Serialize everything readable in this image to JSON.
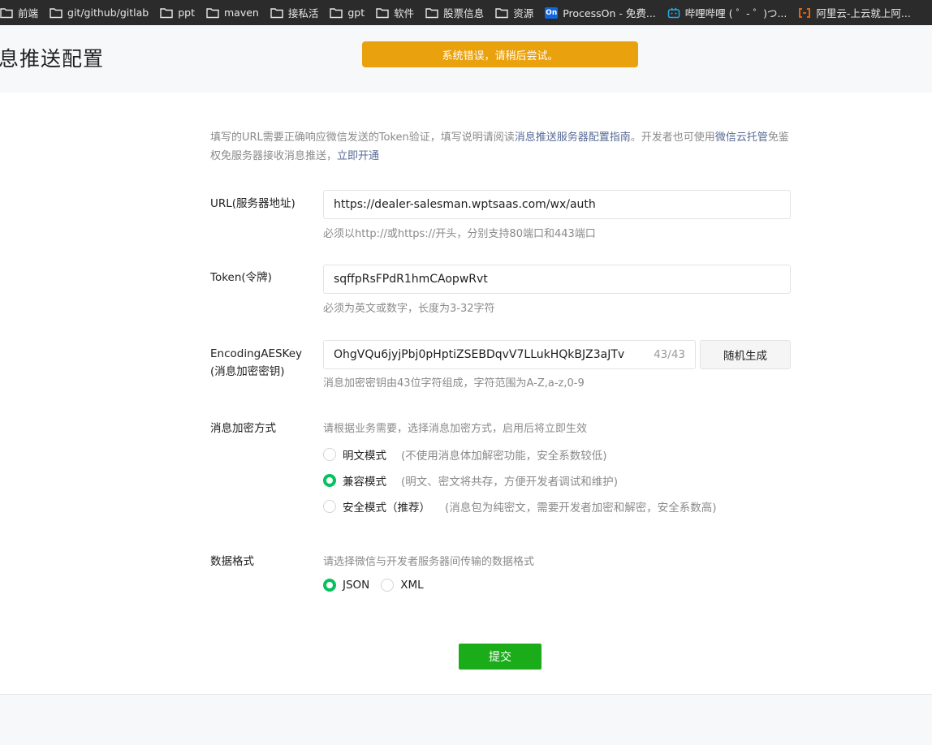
{
  "bookmarks": [
    {
      "label": "前端",
      "icon": "folder-icon"
    },
    {
      "label": "git/github/gitlab",
      "icon": "folder-icon"
    },
    {
      "label": "ppt",
      "icon": "folder-icon"
    },
    {
      "label": "maven",
      "icon": "folder-icon"
    },
    {
      "label": "接私活",
      "icon": "folder-icon"
    },
    {
      "label": "gpt",
      "icon": "folder-icon"
    },
    {
      "label": "软件",
      "icon": "folder-icon"
    },
    {
      "label": "股票信息",
      "icon": "folder-icon"
    },
    {
      "label": "资源",
      "icon": "folder-icon"
    },
    {
      "label": "ProcessOn - 免费...",
      "icon": "processon-icon",
      "badge": "On"
    },
    {
      "label": "哔哩哔哩 ( ゜- ゜)つ...",
      "icon": "bilibili-icon"
    },
    {
      "label": "阿里云-上云就上阿...",
      "icon": "aliyun-icon"
    }
  ],
  "header": {
    "title": "息推送配置",
    "toast": "系统错误，请稍后尝试。"
  },
  "intro": {
    "part1": "填写的URL需要正确响应微信发送的Token验证，填写说明请阅读",
    "link1": "消息推送服务器配置指南",
    "part2": "。开发者也可使用",
    "link2": "微信云托管",
    "part3": "免鉴权免服务器接收消息推送，",
    "link3": "立即开通"
  },
  "form": {
    "url": {
      "label": "URL(服务器地址)",
      "value": "https://dealer-salesman.wptsaas.com/wx/auth",
      "hint": "必须以http://或https://开头，分别支持80端口和443端口"
    },
    "token": {
      "label": "Token(令牌)",
      "value": "sqffpRsFPdR1hmCAopwRvt",
      "hint": "必须为英文或数字，长度为3-32字符"
    },
    "aeskey": {
      "label_line1": "EncodingAESKey",
      "label_line2": "(消息加密密钥)",
      "value": "OhgVQu6jyjPbj0pHptiZSEBDqvV7LLukHQkBJZ3aJTv",
      "counter": "43/43",
      "generate_label": "随机生成",
      "hint": "消息加密密钥由43位字符组成，字符范围为A-Z,a-z,0-9"
    },
    "encryption": {
      "label": "消息加密方式",
      "hint": "请根据业务需要，选择消息加密方式，启用后将立即生效",
      "options": [
        {
          "label": "明文模式",
          "desc": "(不使用消息体加解密功能，安全系数较低)",
          "checked": false
        },
        {
          "label": "兼容模式",
          "desc": "(明文、密文将共存，方便开发者调试和维护)",
          "checked": true
        },
        {
          "label": "安全模式（推荐）",
          "desc": "(消息包为纯密文，需要开发者加密和解密，安全系数高)",
          "checked": false
        }
      ]
    },
    "format": {
      "label": "数据格式",
      "hint": "请选择微信与开发者服务器间传输的数据格式",
      "options": [
        {
          "label": "JSON",
          "checked": true
        },
        {
          "label": "XML",
          "checked": false
        }
      ]
    },
    "submit_label": "提交"
  },
  "colors": {
    "accent_green": "#07c160",
    "button_green": "#1aad19",
    "toast_orange": "#e9a10d",
    "link_blue": "#576b95"
  }
}
